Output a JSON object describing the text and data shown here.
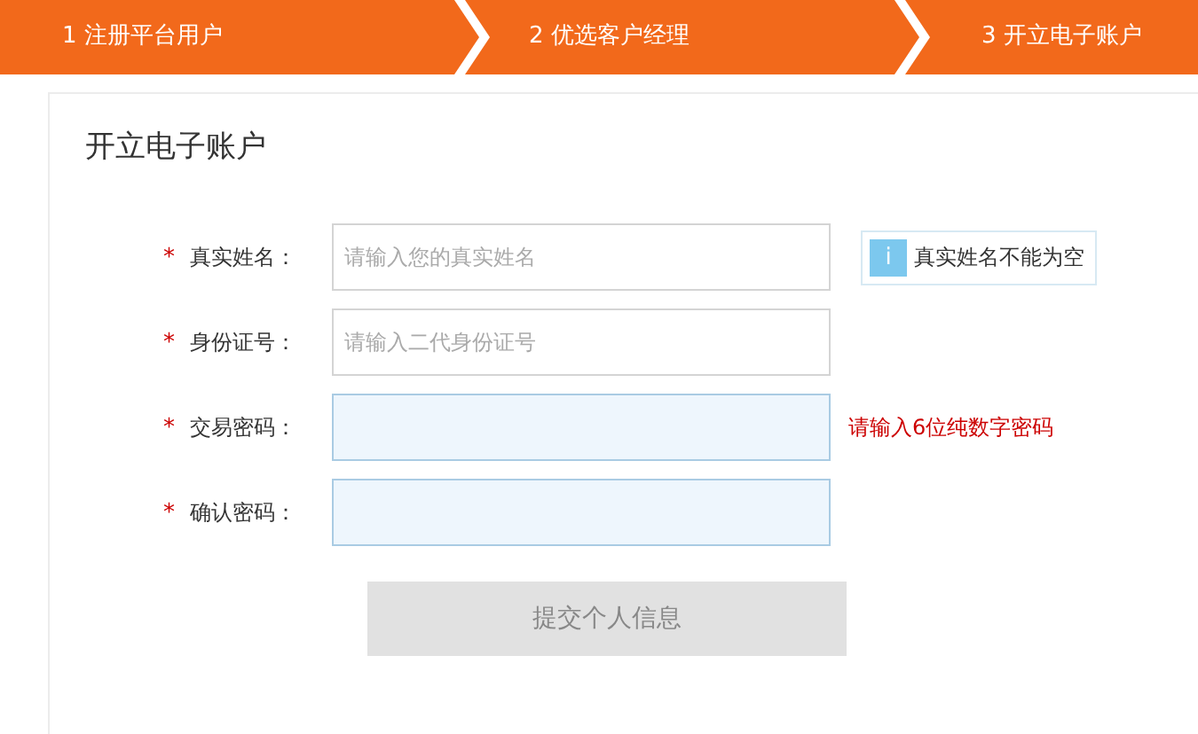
{
  "steps": [
    {
      "label": "1 注册平台用户"
    },
    {
      "label": "2 优选客户经理"
    },
    {
      "label": "3 开立电子账户"
    }
  ],
  "form": {
    "title": "开立电子账户",
    "fields": [
      {
        "required_mark": "*",
        "label": "真实姓名：",
        "placeholder": "请输入您的真实姓名",
        "highlighted": false,
        "message": {
          "kind": "info",
          "icon": "i",
          "text": "真实姓名不能为空"
        }
      },
      {
        "required_mark": "*",
        "label": "身份证号：",
        "placeholder": "请输入二代身份证号",
        "highlighted": false
      },
      {
        "required_mark": "*",
        "label": "交易密码：",
        "highlighted": true,
        "message": {
          "kind": "error",
          "text": "请输入6位纯数字密码"
        }
      },
      {
        "required_mark": "*",
        "label": "确认密码：",
        "highlighted": true
      }
    ],
    "submit": {
      "label": "提交个人信息",
      "disabled": true
    }
  }
}
